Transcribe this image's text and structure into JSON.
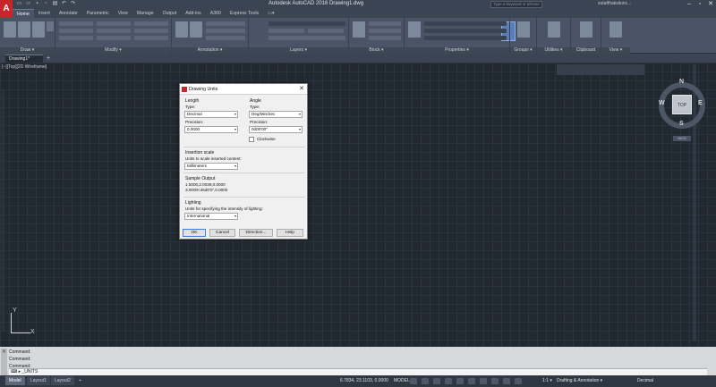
{
  "window": {
    "title": "Autodesk AutoCAD 2016    Drawing1.dwg",
    "search_placeholder": "Type a keyword or phrase",
    "user": "sutatfhaksilunc..."
  },
  "app_logo": "A",
  "ribbon_tabs": [
    "Home",
    "Insert",
    "Annotate",
    "Parametric",
    "View",
    "Manage",
    "Output",
    "Add-ins",
    "A360",
    "Express Tools",
    "▭▾"
  ],
  "ribbon_panels": {
    "draw": "Draw ▾",
    "modify": "Modify ▾",
    "annotation": "Annotation ▾",
    "layers": "Layers ▾",
    "block": "Block ▾",
    "properties": "Properties ▾",
    "groups": "Groups ▾",
    "utilities": "Utilities ▾",
    "clipboard": "Clipboard",
    "view": "View ▾"
  },
  "doc_tab": "Drawing1*",
  "doc_tab_add": "+",
  "viewport_label": "[−][Top][2D Wireframe]",
  "viewcube": {
    "face": "TOP",
    "north": "N",
    "south": "S",
    "east": "E",
    "west": "W",
    "wcs": "WCS"
  },
  "ucs": {
    "x": "X",
    "y": "Y"
  },
  "command": {
    "history": [
      "Command:",
      "Command:",
      "Command:"
    ],
    "input": "⌨ ▸ _UNITS"
  },
  "status": {
    "tabs": [
      "Model",
      "Layout1",
      "Layout2"
    ],
    "add_tab": "+",
    "coords": "6.7834, 23.1103, 0.0000",
    "model": "MODEL",
    "scale": "1:1 ▾",
    "workspace": "Drafting & Annotation ▾",
    "units": "Decimal"
  },
  "dialog": {
    "title": "Drawing Units",
    "close": "✕",
    "length": {
      "label": "Length",
      "type_label": "Type:",
      "type_value": "Decimal",
      "precision_label": "Precision:",
      "precision_value": "0.0000"
    },
    "angle": {
      "label": "Angle",
      "type_label": "Type:",
      "type_value": "Deg/Min/Sec",
      "precision_label": "Precision:",
      "precision_value": "0d00'00\"",
      "clockwise_label": "Clockwise",
      "clockwise_checked": false
    },
    "insertion": {
      "label": "Insertion scale",
      "sub_label": "Units to scale inserted content:",
      "value": "Millimeters"
    },
    "sample": {
      "label": "Sample Output",
      "line1": "1.5000,2.0039,0.0000",
      "line2": "3.0000<45d0'0\",0.0000"
    },
    "lighting": {
      "label": "Lighting",
      "sub_label": "Units for specifying the intensity of lighting:",
      "value": "International"
    },
    "buttons": {
      "ok": "OK",
      "cancel": "Cancel",
      "direction": "Direction...",
      "help": "Help"
    }
  }
}
